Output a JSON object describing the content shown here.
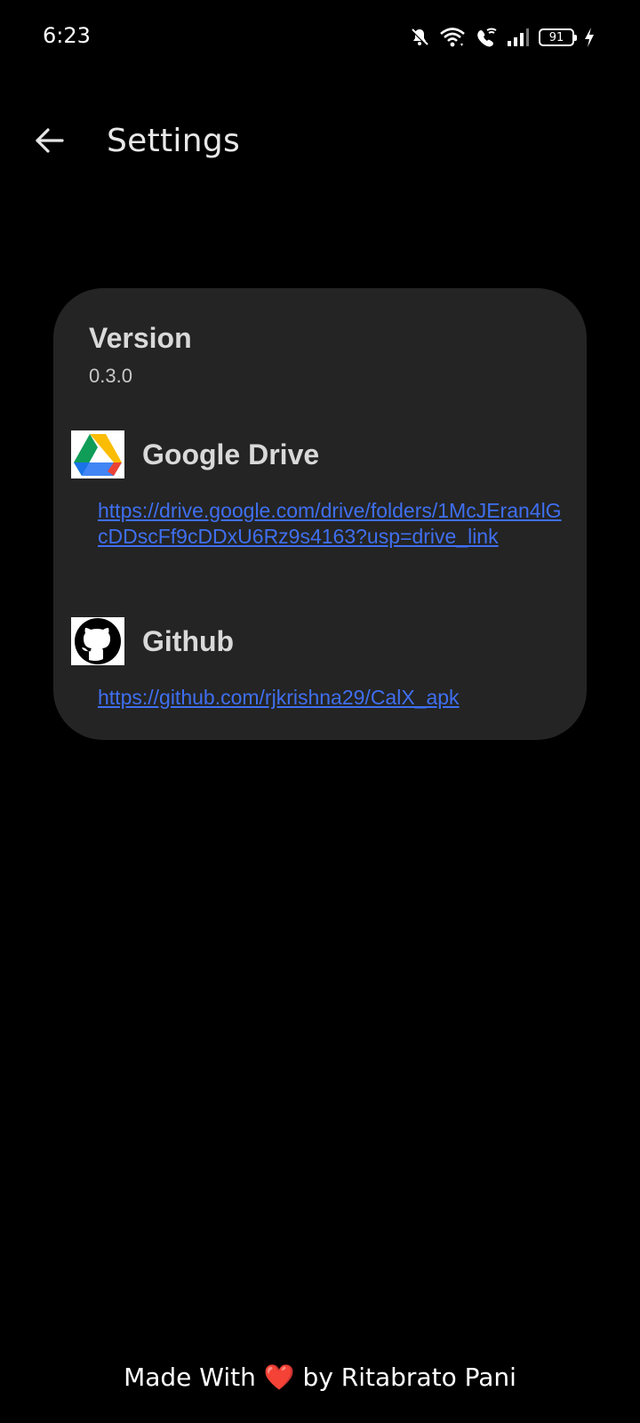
{
  "status_bar": {
    "time": "6:23",
    "battery": "91",
    "icons": [
      "bell-off-icon",
      "wifi-icon",
      "wifi-call-icon",
      "signal-icon",
      "battery-icon",
      "charging-icon"
    ]
  },
  "app_bar": {
    "back_icon": "arrow-back-icon",
    "title": "Settings"
  },
  "card": {
    "version_label": "Version",
    "version_value": "0.3.0",
    "drive": {
      "title": "Google Drive",
      "icon": "google-drive-icon",
      "url": "https://drive.google.com/drive/folders/1McJEran4lGcDDscFf9cDDxU6Rz9s4163?usp=drive_link"
    },
    "github": {
      "title": "Github",
      "icon": "github-icon",
      "url": "https://github.com/rjkrishna29/CalX_apk"
    }
  },
  "footer": {
    "prefix": "Made With",
    "heart": "❤️",
    "suffix": "by Ritabrato Pani"
  },
  "colors": {
    "background": "#000000",
    "card": "#242424",
    "link": "#3f6ff0",
    "heart": "#e53935"
  }
}
